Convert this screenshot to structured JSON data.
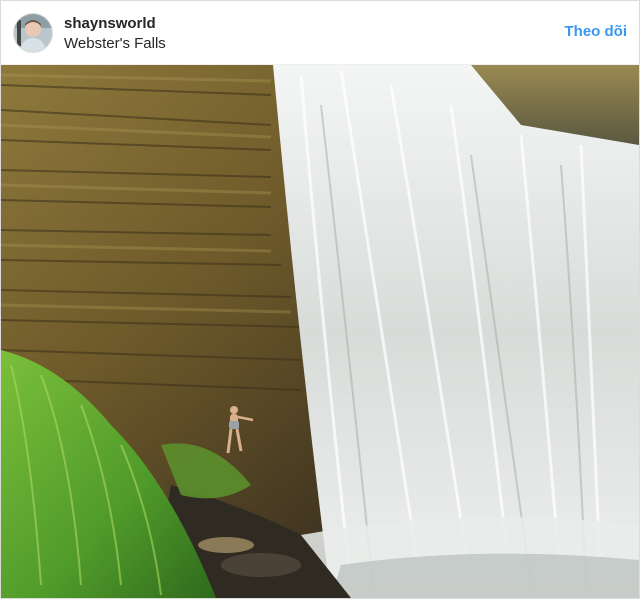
{
  "post": {
    "username": "shaynsworld",
    "location": "Webster's Falls",
    "follow_label": "Theo dõi",
    "avatar_icon": "profile-avatar-icon",
    "photo_icon": "waterfall-photo"
  },
  "colors": {
    "link_blue": "#3897f0",
    "text": "#262626",
    "border": "#dbdbdb"
  }
}
